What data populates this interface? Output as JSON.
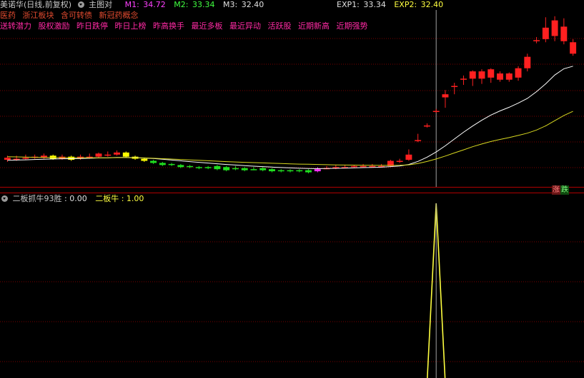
{
  "header": {
    "stock_title": "美诺华(日线,前复权)",
    "main_chart_label": "主图对",
    "m1_label": "M1:",
    "m1_value": "34.72",
    "m2_label": "M2:",
    "m2_value": "33.34",
    "m3_label": "M3:",
    "m3_value": "32.40",
    "exp1_label": "EXP1:",
    "exp1_value": "33.34",
    "exp2_label": "EXP2:",
    "exp2_value": "32.40"
  },
  "tags_line1": [
    "医药",
    "浙江板块",
    "含可转债",
    "新冠药概念"
  ],
  "tags_line2": [
    "送转潜力",
    "股权激励",
    "昨日跌停",
    "昨日上榜",
    "昨高换手",
    "最近多板",
    "最近异动",
    "活跃股",
    "近期新高",
    "近期强势"
  ],
  "badges": {
    "up": "涨",
    "down": "跌"
  },
  "sub_header": {
    "ind1_label": "二板抓牛93胜",
    "ind1_value": ": 0.00",
    "ind2_label": "二板牛",
    "ind2_value": ": 1.00"
  },
  "colors": {
    "m1": "#ff40ff",
    "m2": "#40ff40",
    "m3": "#e0e0e0",
    "exp1": "#e0e0e0",
    "exp2": "#ffff40",
    "up": "#ff2020",
    "down": "#20e020",
    "yellow_candle": "#ffff00",
    "magenta_candle": "#ff30ff",
    "grid": "#7a0000",
    "line_white": "#ffffff",
    "line_yellow": "#d8d820",
    "cursor": "#a0a0a0"
  },
  "chart_data": [
    {
      "type": "candlestick",
      "title": "美诺华(日线,前复权)",
      "ylim": [
        23,
        40
      ],
      "candles": [
        {
          "o": 25.6,
          "c": 25.8,
          "h": 26.0,
          "l": 25.4,
          "color": "up"
        },
        {
          "o": 25.7,
          "c": 25.7,
          "h": 26.0,
          "l": 25.5,
          "color": "up"
        },
        {
          "o": 25.8,
          "c": 25.8,
          "h": 26.1,
          "l": 25.6,
          "color": "up"
        },
        {
          "o": 25.9,
          "c": 25.9,
          "h": 26.1,
          "l": 25.7,
          "color": "up"
        },
        {
          "o": 25.8,
          "c": 26.0,
          "h": 26.2,
          "l": 25.7,
          "color": "up"
        },
        {
          "o": 26.0,
          "c": 25.7,
          "h": 26.1,
          "l": 25.6,
          "color": "yellow"
        },
        {
          "o": 25.7,
          "c": 25.9,
          "h": 26.1,
          "l": 25.6,
          "color": "up"
        },
        {
          "o": 25.9,
          "c": 25.6,
          "h": 26.0,
          "l": 25.5,
          "color": "yellow"
        },
        {
          "o": 25.7,
          "c": 25.9,
          "h": 26.1,
          "l": 25.6,
          "color": "up"
        },
        {
          "o": 25.9,
          "c": 25.9,
          "h": 26.2,
          "l": 25.7,
          "color": "up"
        },
        {
          "o": 25.9,
          "c": 26.2,
          "h": 26.3,
          "l": 25.8,
          "color": "up"
        },
        {
          "o": 26.1,
          "c": 26.1,
          "h": 26.4,
          "l": 25.9,
          "color": "up"
        },
        {
          "o": 26.1,
          "c": 26.3,
          "h": 26.5,
          "l": 26.0,
          "color": "up"
        },
        {
          "o": 26.3,
          "c": 25.9,
          "h": 26.4,
          "l": 25.8,
          "color": "yellow"
        },
        {
          "o": 25.9,
          "c": 25.7,
          "h": 26.0,
          "l": 25.6,
          "color": "yellow"
        },
        {
          "o": 25.7,
          "c": 25.5,
          "h": 25.8,
          "l": 25.4,
          "color": "yellow"
        },
        {
          "o": 25.5,
          "c": 25.3,
          "h": 25.6,
          "l": 25.2,
          "color": "down"
        },
        {
          "o": 25.3,
          "c": 25.1,
          "h": 25.4,
          "l": 25.0,
          "color": "down"
        },
        {
          "o": 25.2,
          "c": 25.1,
          "h": 25.3,
          "l": 25.0,
          "color": "down"
        },
        {
          "o": 25.1,
          "c": 24.9,
          "h": 25.2,
          "l": 24.8,
          "color": "down"
        },
        {
          "o": 25.0,
          "c": 24.9,
          "h": 25.1,
          "l": 24.8,
          "color": "down"
        },
        {
          "o": 24.9,
          "c": 24.8,
          "h": 25.0,
          "l": 24.7,
          "color": "down"
        },
        {
          "o": 24.9,
          "c": 24.8,
          "h": 25.0,
          "l": 24.7,
          "color": "down"
        },
        {
          "o": 25.0,
          "c": 24.7,
          "h": 25.1,
          "l": 24.6,
          "color": "down"
        },
        {
          "o": 24.9,
          "c": 24.6,
          "h": 25.0,
          "l": 24.5,
          "color": "down"
        },
        {
          "o": 24.8,
          "c": 24.8,
          "h": 25.0,
          "l": 24.6,
          "color": "down"
        },
        {
          "o": 24.8,
          "c": 24.6,
          "h": 24.9,
          "l": 24.5,
          "color": "down"
        },
        {
          "o": 24.7,
          "c": 24.7,
          "h": 24.9,
          "l": 24.6,
          "color": "down"
        },
        {
          "o": 24.8,
          "c": 24.6,
          "h": 24.9,
          "l": 24.5,
          "color": "down"
        },
        {
          "o": 24.7,
          "c": 24.5,
          "h": 24.8,
          "l": 24.4,
          "color": "down"
        },
        {
          "o": 24.6,
          "c": 24.5,
          "h": 24.7,
          "l": 24.4,
          "color": "down"
        },
        {
          "o": 24.6,
          "c": 24.5,
          "h": 24.7,
          "l": 24.4,
          "color": "down"
        },
        {
          "o": 24.6,
          "c": 24.5,
          "h": 24.7,
          "l": 24.4,
          "color": "down"
        },
        {
          "o": 24.6,
          "c": 24.4,
          "h": 24.7,
          "l": 24.3,
          "color": "down"
        },
        {
          "o": 24.5,
          "c": 24.7,
          "h": 24.9,
          "l": 24.4,
          "color": "magenta"
        },
        {
          "o": 24.8,
          "c": 24.8,
          "h": 25.0,
          "l": 24.7,
          "color": "up"
        },
        {
          "o": 24.8,
          "c": 24.9,
          "h": 25.1,
          "l": 24.7,
          "color": "up"
        },
        {
          "o": 24.9,
          "c": 24.9,
          "h": 25.1,
          "l": 24.8,
          "color": "up"
        },
        {
          "o": 24.9,
          "c": 25.0,
          "h": 25.1,
          "l": 24.8,
          "color": "up"
        },
        {
          "o": 25.0,
          "c": 25.0,
          "h": 25.2,
          "l": 24.9,
          "color": "up"
        },
        {
          "o": 25.0,
          "c": 25.0,
          "h": 25.2,
          "l": 24.9,
          "color": "up"
        },
        {
          "o": 25.0,
          "c": 25.0,
          "h": 25.2,
          "l": 24.9,
          "color": "up"
        },
        {
          "o": 25.0,
          "c": 25.5,
          "h": 25.6,
          "l": 24.9,
          "color": "up"
        },
        {
          "o": 25.4,
          "c": 25.5,
          "h": 25.7,
          "l": 25.3,
          "color": "up"
        },
        {
          "o": 25.6,
          "c": 26.1,
          "h": 26.6,
          "l": 25.5,
          "color": "up"
        },
        {
          "o": 27.5,
          "c": 27.5,
          "h": 28.1,
          "l": 27.3,
          "color": "up"
        },
        {
          "o": 28.9,
          "c": 28.9,
          "h": 29.1,
          "l": 28.7,
          "color": "up"
        },
        {
          "o": 30.3,
          "c": 30.3,
          "h": 30.5,
          "l": 30.1,
          "color": "up"
        },
        {
          "o": 31.6,
          "c": 31.9,
          "h": 32.3,
          "l": 30.6,
          "color": "up"
        },
        {
          "o": 32.6,
          "c": 32.7,
          "h": 33.0,
          "l": 31.9,
          "color": "up"
        },
        {
          "o": 33.4,
          "c": 33.4,
          "h": 33.7,
          "l": 32.8,
          "color": "up"
        },
        {
          "o": 33.4,
          "c": 34.1,
          "h": 34.2,
          "l": 32.7,
          "color": "up"
        },
        {
          "o": 33.4,
          "c": 34.1,
          "h": 34.3,
          "l": 32.9,
          "color": "up"
        },
        {
          "o": 33.5,
          "c": 34.3,
          "h": 34.4,
          "l": 33.0,
          "color": "up"
        },
        {
          "o": 33.3,
          "c": 33.9,
          "h": 34.1,
          "l": 33.1,
          "color": "up"
        },
        {
          "o": 33.3,
          "c": 33.9,
          "h": 34.0,
          "l": 33.1,
          "color": "up"
        },
        {
          "o": 33.5,
          "c": 34.4,
          "h": 34.6,
          "l": 33.2,
          "color": "up"
        },
        {
          "o": 34.4,
          "c": 35.5,
          "h": 35.8,
          "l": 34.1,
          "color": "up"
        },
        {
          "o": 37.1,
          "c": 37.1,
          "h": 37.4,
          "l": 36.8,
          "color": "up"
        },
        {
          "o": 37.2,
          "c": 38.3,
          "h": 39.3,
          "l": 36.9,
          "color": "up"
        },
        {
          "o": 37.5,
          "c": 39.0,
          "h": 39.4,
          "l": 37.0,
          "color": "up"
        },
        {
          "o": 38.4,
          "c": 37.0,
          "h": 39.2,
          "l": 36.7,
          "color": "up"
        },
        {
          "o": 36.9,
          "c": 35.8,
          "h": 37.2,
          "l": 35.6,
          "color": "up"
        }
      ],
      "series": [
        {
          "name": "EXP1",
          "color": "line_white",
          "values": [
            25.55,
            25.58,
            25.6,
            25.63,
            25.66,
            25.68,
            25.7,
            25.71,
            25.73,
            25.75,
            25.78,
            25.8,
            25.83,
            25.83,
            25.81,
            25.77,
            25.72,
            25.65,
            25.58,
            25.5,
            25.43,
            25.36,
            25.29,
            25.22,
            25.15,
            25.1,
            25.04,
            24.99,
            24.95,
            24.9,
            24.86,
            24.82,
            24.79,
            24.76,
            24.75,
            24.76,
            24.78,
            24.8,
            24.82,
            24.85,
            24.87,
            24.89,
            24.95,
            25.0,
            25.15,
            25.45,
            25.85,
            26.35,
            26.95,
            27.6,
            28.25,
            28.85,
            29.4,
            29.9,
            30.3,
            30.65,
            31.05,
            31.5,
            32.15,
            32.9,
            33.75,
            34.35,
            34.6
          ]
        },
        {
          "name": "EXP2",
          "color": "line_yellow",
          "values": [
            25.9,
            25.88,
            25.86,
            25.84,
            25.83,
            25.82,
            25.81,
            25.8,
            25.79,
            25.79,
            25.8,
            25.8,
            25.81,
            25.81,
            25.8,
            25.78,
            25.75,
            25.71,
            25.67,
            25.63,
            25.59,
            25.55,
            25.51,
            25.47,
            25.43,
            25.39,
            25.36,
            25.33,
            25.3,
            25.27,
            25.24,
            25.21,
            25.19,
            25.17,
            25.15,
            25.13,
            25.11,
            25.1,
            25.09,
            25.08,
            25.07,
            25.06,
            25.06,
            25.07,
            25.12,
            25.25,
            25.44,
            25.68,
            25.96,
            26.26,
            26.56,
            26.86,
            27.12,
            27.36,
            27.56,
            27.74,
            27.94,
            28.16,
            28.46,
            28.86,
            29.36,
            29.86,
            30.26
          ]
        }
      ]
    },
    {
      "type": "line",
      "series": [
        {
          "name": "二板牛",
          "color": "yellow",
          "values": [
            0,
            0,
            0,
            0,
            0,
            0,
            0,
            0,
            0,
            0,
            0,
            0,
            0,
            0,
            0,
            0,
            0,
            0,
            0,
            0,
            0,
            0,
            0,
            0,
            0,
            0,
            0,
            0,
            0,
            0,
            0,
            0,
            0,
            0,
            0,
            0,
            0,
            0,
            0,
            0,
            0,
            0,
            0,
            0,
            0,
            0,
            0,
            1,
            0,
            0,
            0,
            0,
            0,
            0,
            0,
            0,
            0,
            0,
            0,
            0,
            0,
            0,
            0
          ]
        }
      ],
      "ylim": [
        0,
        1
      ]
    }
  ]
}
